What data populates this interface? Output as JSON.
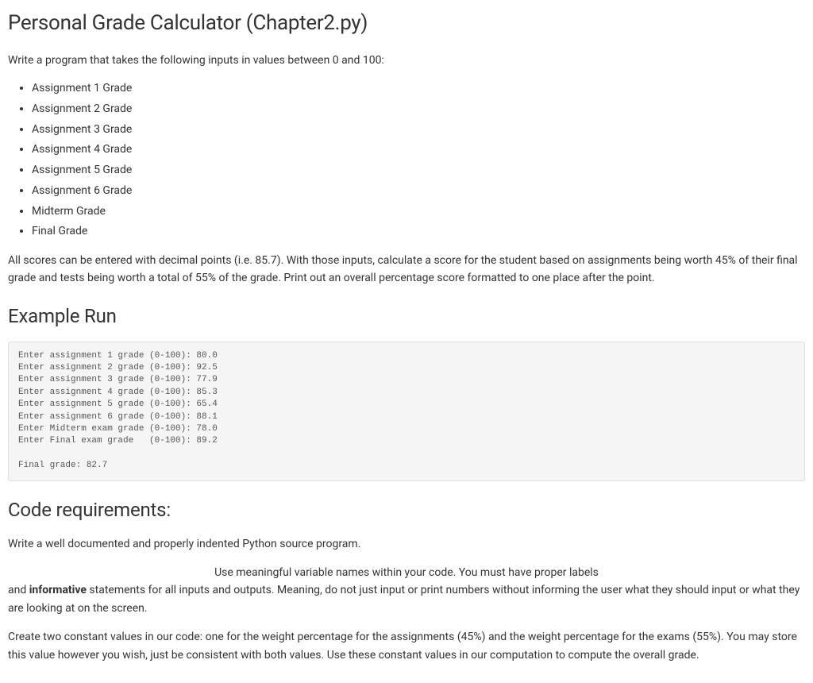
{
  "title": "Personal Grade Calculator (Chapter2.py)",
  "intro": "Write a program that takes the following inputs in values between 0 and 100:",
  "inputs": [
    "Assignment 1 Grade",
    "Assignment 2 Grade",
    "Assignment 3 Grade",
    "Assignment 4 Grade",
    "Assignment 5 Grade",
    "Assignment 6 Grade",
    "Midterm Grade",
    "Final Grade"
  ],
  "desc": "All scores can be entered with decimal points (i.e. 85.7). With those inputs, calculate a score for the student based on assignments being worth 45% of their final grade and tests being worth a total of 55% of the grade. Print out an overall percentage score formatted to one place after the point.",
  "exampleHeading": "Example Run",
  "exampleRun": "Enter assignment 1 grade (0-100): 80.0\nEnter assignment 2 grade (0-100): 92.5\nEnter assignment 3 grade (0-100): 77.9\nEnter assignment 4 grade (0-100): 85.3\nEnter assignment 5 grade (0-100): 65.4\nEnter assignment 6 grade (0-100): 88.1\nEnter Midterm exam grade (0-100): 78.0\nEnter Final exam grade   (0-100): 89.2\n\nFinal grade: 82.7",
  "codeReqHeading": "Code requirements:",
  "req1": "Write a well documented and properly indented Python source program.",
  "req2_centered": "Use meaningful variable names within your code. You must have proper labels",
  "req2_part_a": "and ",
  "req2_bold": "informative",
  "req2_part_b": " statements for all inputs and outputs. Meaning, do not just input or print numbers without informing the user what they should input or what they are looking at on the screen.",
  "req3": "Create two constant values in our code: one for the weight percentage for the assignments (45%) and the weight percentage for the exams (55%).  You may store this value however you wish, just be consistent with both values. Use these constant values in our computation to compute the overall grade."
}
